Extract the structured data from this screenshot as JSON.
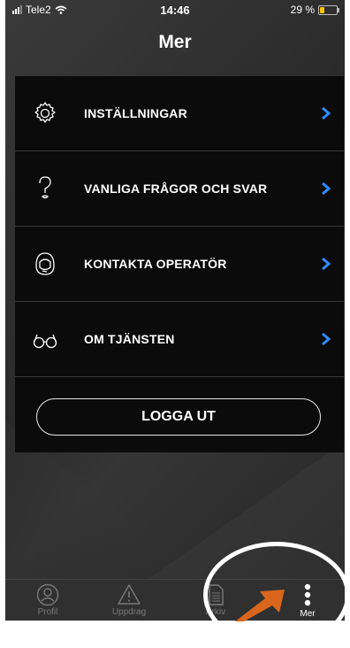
{
  "status_bar": {
    "carrier": "Tele2",
    "time": "14:46",
    "battery": "29 %",
    "battery_level": 0.29
  },
  "header": {
    "title": "Mer"
  },
  "menu": {
    "items": [
      {
        "label": "INSTÄLLNINGAR",
        "icon": "gear-icon"
      },
      {
        "label": "VANLIGA FRÅGOR OCH SVAR",
        "icon": "question-icon"
      },
      {
        "label": "KONTAKTA OPERATÖR",
        "icon": "operator-icon"
      },
      {
        "label": "OM TJÄNSTEN",
        "icon": "glasses-icon"
      }
    ],
    "logout_label": "LOGGA UT"
  },
  "tabbar": {
    "tabs": [
      {
        "label": "Profil",
        "icon": "profile-icon",
        "active": false
      },
      {
        "label": "Uppdrag",
        "icon": "warning-icon",
        "active": false
      },
      {
        "label": "Arkiv",
        "icon": "document-icon",
        "active": false
      },
      {
        "label": "Mer",
        "icon": "more-dots-icon",
        "active": true
      }
    ]
  },
  "colors": {
    "accent": "#2e8cff",
    "background": "#2e2e2e",
    "card": "#0b0b0b",
    "annotation_arrow": "#d9661c"
  }
}
